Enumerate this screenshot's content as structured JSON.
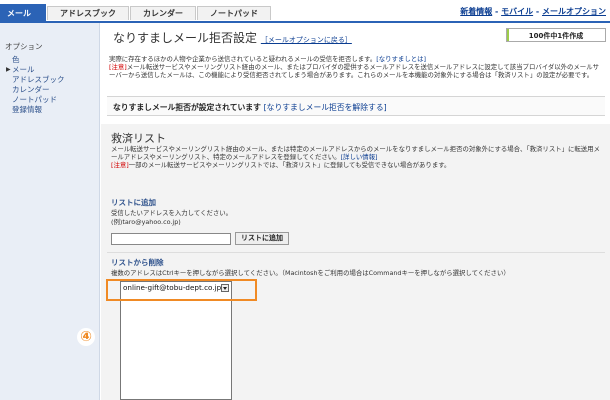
{
  "tabs": [
    {
      "label": "メール",
      "active": true
    },
    {
      "label": "アドレスブック",
      "active": false
    },
    {
      "label": "カレンダー",
      "active": false
    },
    {
      "label": "ノートパッド",
      "active": false
    }
  ],
  "top_links": {
    "items": [
      "新着情報",
      "モバイル",
      "メールオプション"
    ],
    "separator": " - "
  },
  "sidebar": {
    "title": "オプション",
    "items": [
      {
        "label": "色",
        "current": false
      },
      {
        "label": "メール",
        "current": true
      },
      {
        "label": "アドレスブック",
        "current": false
      },
      {
        "label": "カレンダー",
        "current": false
      },
      {
        "label": "ノートパッド",
        "current": false
      },
      {
        "label": "登録情報",
        "current": false
      }
    ]
  },
  "header": {
    "title": "なりすましメール拒否設定",
    "back_link": "［メールオプションに戻る］",
    "capacity_label": "100件中1件作成",
    "capacity_fraction": 0.01
  },
  "description": {
    "line1": "実際に存在するほかの人物や企業から送信されていると疑われるメールの受信を拒否します。",
    "line1_link": "[なりすましとは]",
    "warn_label": "[注意]",
    "line2": "メール転送サービスやメーリングリスト経由のメール、またはプロバイダの提供するメールアドレスを送信メールアドレスに設定して該当プロバイダ以外のメールサーバーから送信したメールは、この機能により受信拒否されてしまう場合があります。これらのメールを本機能の対象外にする場合は「救済リスト」の設定が必要です。"
  },
  "status": {
    "text": "なりすましメール拒否が設定されています",
    "link": "[なりすましメール拒否を解除する]"
  },
  "safe_list": {
    "title": "救済リスト",
    "desc1": "メール転送サービスやメーリングリスト経由のメール、または特定のメールアドレスからのメールをなりすましメール拒否の対象外にする場合、「救済リスト」に転送用メールアドレスやメーリングリスト、特定のメールアドレスを登録してください。",
    "desc1_link": "[詳しい情報]",
    "warn_label": "[注意]",
    "desc2": "一部のメール転送サービスやメーリングリストでは、「救済リスト」に登録しても受信できない場合があります。"
  },
  "add_section": {
    "title": "リストに追加",
    "help1": "受信したいアドレスを入力してください。",
    "help2": "(例)taro@yahoo.co.jp)",
    "input_value": "",
    "button_label": "リストに追加"
  },
  "delete_section": {
    "title": "リストから削除",
    "help": "複数のアドレスはCtrlキーを押しながら選択してください。（Macintoshをご利用の場合はCommandキーを押しながら選択してください）",
    "list_items": [
      "online-gift@tobu-dept.co.jp"
    ]
  },
  "annotation": {
    "step_marker": "④",
    "highlight_color": "#f08a24"
  }
}
